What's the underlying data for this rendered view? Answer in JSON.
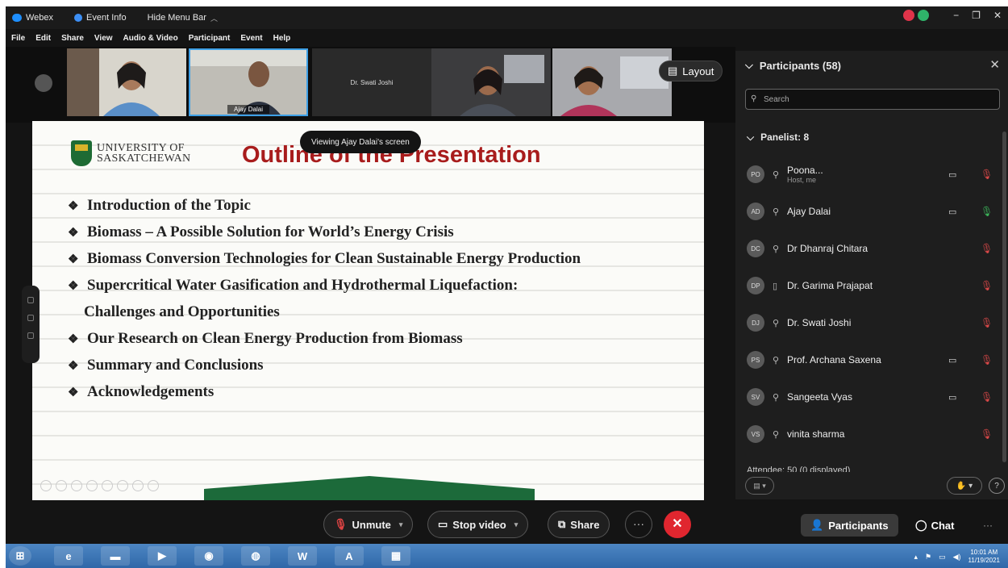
{
  "titlebar": {
    "app_name": "Webex",
    "event_info": "Event Info",
    "hide_menu_bar": "Hide Menu Bar",
    "minimize": "−",
    "restore": "❐",
    "close": "✕"
  },
  "menu": [
    "File",
    "Edit",
    "Share",
    "View",
    "Audio & Video",
    "Participant",
    "Event",
    "Help"
  ],
  "video_tiles": [
    {
      "name": "",
      "bg": "#6a6862"
    },
    {
      "name": "Ajay Dalai",
      "bg": "#7d7d78"
    },
    {
      "name": "",
      "text": "Dr. Swati Joshi",
      "bg": "#1b1b1b"
    },
    {
      "name": "",
      "bg": "#4e4a46"
    },
    {
      "name": "",
      "bg": "#8a8986"
    }
  ],
  "layout_label": "Layout",
  "share_banner": "Viewing Ajay Dalai's screen",
  "slide": {
    "university_line1": "UNIVERSITY OF",
    "university_line2": "SASKATCHEWAN",
    "title": "Outline of the Presentation",
    "bullets": [
      "Introduction of the Topic",
      "Biomass – A Possible Solution for World’s Energy Crisis",
      "Biomass Conversion Technologies for Clean Sustainable Energy Production",
      "Supercritical Water Gasification and Hydrothermal Liquefaction:",
      "Challenges and Opportunities",
      "Our Research on Clean Energy Production from Biomass",
      "Summary and Conclusions",
      "Acknowledgements"
    ]
  },
  "participants_panel": {
    "title": "Participants (58)",
    "search_placeholder": "Search",
    "panelist_header": "Panelist: 8",
    "attendee_header": "Attendee: 50 (0 displayed)",
    "panelists": [
      {
        "initials": "PO",
        "name": "Poona...",
        "sub": "Host, me",
        "video": true,
        "mic": "muted"
      },
      {
        "initials": "AD",
        "name": "Ajay Dalai",
        "sub": "",
        "video": true,
        "mic": "on"
      },
      {
        "initials": "DC",
        "name": "Dr Dhanraj Chitara",
        "sub": "",
        "video": false,
        "mic": "muted"
      },
      {
        "initials": "DP",
        "name": "Dr. Garima Prajapat",
        "sub": "",
        "video": false,
        "mic": "muted"
      },
      {
        "initials": "DJ",
        "name": "Dr. Swati Joshi",
        "sub": "",
        "video": false,
        "mic": "muted"
      },
      {
        "initials": "PS",
        "name": "Prof. Archana Saxena",
        "sub": "",
        "video": true,
        "mic": "muted"
      },
      {
        "initials": "SV",
        "name": "Sangeeta Vyas",
        "sub": "",
        "video": true,
        "mic": "muted"
      },
      {
        "initials": "VS",
        "name": "vinita sharma",
        "sub": "",
        "video": false,
        "mic": "muted"
      }
    ]
  },
  "controls": {
    "unmute": "Unmute",
    "stop_video": "Stop video",
    "share": "Share",
    "more": "···",
    "end": "✕",
    "participants": "Participants",
    "chat": "Chat"
  },
  "taskbar": {
    "time": "10:01 AM",
    "date": "11/19/2021"
  },
  "colors": {
    "slide_title": "#a81c1c",
    "end_call": "#e0262f",
    "mic_muted": "#d94848",
    "mic_on": "#3cb55a",
    "taskbar": "#3a74b6"
  }
}
